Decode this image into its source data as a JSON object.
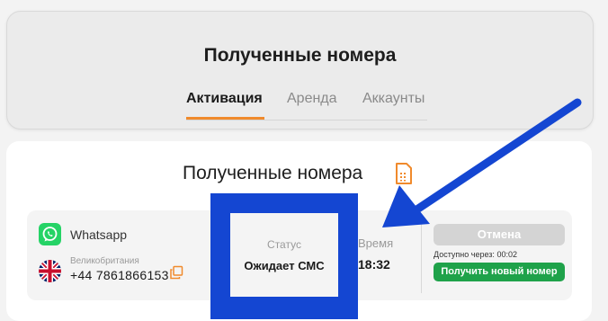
{
  "header": {
    "title": "Полученные номера",
    "tabs": [
      {
        "label": "Активация",
        "active": true
      },
      {
        "label": "Аренда",
        "active": false
      },
      {
        "label": "Аккаунты",
        "active": false
      }
    ]
  },
  "section": {
    "title": "Полученные номера",
    "icon": "sim-card-icon"
  },
  "number": {
    "service": "Whatsapp",
    "country": "Великобритания",
    "phone": "+44 7861866153",
    "status_label": "Статус",
    "status_value": "Ожидает СМС",
    "time_label": "Время",
    "time_value": "18:32",
    "cancel_label": "Отмена",
    "available_label": "Доступно через:",
    "available_time": "00:02",
    "new_number_label": "Получить новый номер"
  },
  "colors": {
    "accent": "#f08a2c",
    "whatsapp": "#25d366",
    "success": "#1fa24a",
    "highlight": "#1446d2",
    "disabled": "#d4d4d4"
  }
}
